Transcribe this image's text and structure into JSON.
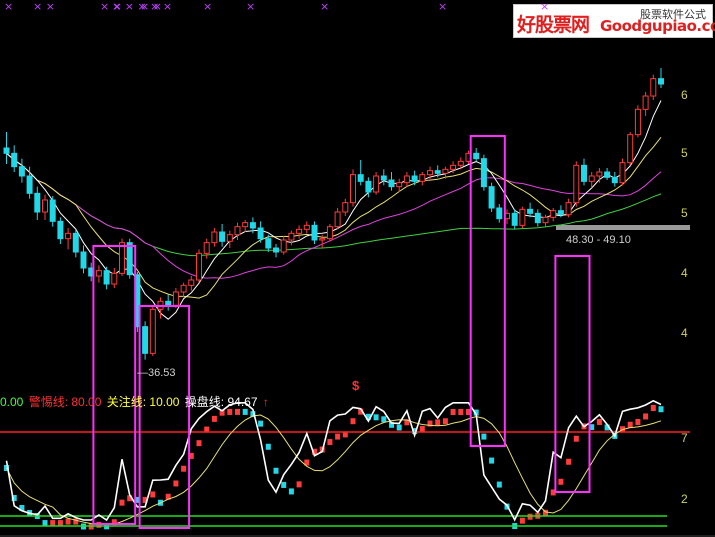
{
  "watermark": {
    "brand": "好股票网",
    "url": "Goodgupiao.com",
    "sub": "股票软件公式"
  },
  "indicator_labels": [
    {
      "text": "0.00",
      "color": "#40ff40"
    },
    {
      "text": "警惕线: 80.00",
      "color": "#ff3030"
    },
    {
      "text": "关注线: 10.00",
      "color": "#ffff40"
    },
    {
      "text": "操盘线: 94.67",
      "color": "#ffffff"
    }
  ],
  "top_marks": [
    "×",
    "× ×",
    "× ×",
    "× ×",
    "× × × × ×",
    "×",
    "×",
    "×",
    "×",
    "×"
  ],
  "y_axis_labels": [
    "6",
    "5",
    "5",
    "4",
    "4",
    "7",
    "2"
  ],
  "price_labels": {
    "low": "36.53",
    "mid": "48.30 - 49.10"
  },
  "signal_text": "$",
  "colors": {
    "up": "#ff3b3b",
    "down": "#20d8e8",
    "ma5": "#ffffff",
    "ma10": "#e8e070",
    "ma20": "#e040e0",
    "ma60": "#40d040",
    "highlight": "#ff30ff",
    "red_line": "#ff2020",
    "green_line": "#20e020"
  },
  "chart_data": {
    "type": "candlestick",
    "upper": {
      "candles_note": "",
      "ohlc": [
        [
          52.4,
          53.6,
          51.2,
          52.0
        ],
        [
          52.0,
          52.6,
          50.6,
          51.0
        ],
        [
          51.0,
          51.6,
          49.8,
          50.3
        ],
        [
          50.3,
          51.0,
          48.6,
          49.0
        ],
        [
          49.0,
          49.5,
          47.0,
          47.6
        ],
        [
          47.6,
          48.9,
          47.0,
          48.5
        ],
        [
          48.5,
          48.8,
          46.5,
          46.9
        ],
        [
          46.9,
          47.2,
          45.2,
          45.6
        ],
        [
          45.6,
          46.4,
          44.8,
          46.0
        ],
        [
          46.0,
          46.3,
          44.2,
          44.6
        ],
        [
          44.6,
          45.1,
          43.0,
          43.4
        ],
        [
          43.4,
          43.8,
          42.4,
          42.8
        ],
        [
          42.8,
          43.6,
          42.3,
          43.2
        ],
        [
          43.2,
          43.5,
          41.8,
          42.2
        ],
        [
          42.2,
          43.4,
          41.9,
          43.0
        ],
        [
          43.0,
          45.6,
          42.8,
          45.3
        ],
        [
          45.3,
          45.6,
          42.6,
          42.9
        ],
        [
          42.9,
          43.1,
          38.6,
          39.0
        ],
        [
          39.0,
          39.4,
          36.53,
          37.0
        ],
        [
          37.0,
          40.6,
          36.8,
          40.3
        ],
        [
          40.3,
          41.2,
          39.6,
          40.9
        ],
        [
          40.9,
          41.4,
          40.2,
          40.6
        ],
        [
          40.6,
          41.9,
          40.4,
          41.6
        ],
        [
          41.6,
          42.3,
          41.2,
          42.1
        ],
        [
          42.1,
          42.8,
          41.7,
          42.5
        ],
        [
          42.5,
          44.8,
          42.3,
          44.5
        ],
        [
          44.5,
          45.6,
          44.1,
          45.3
        ],
        [
          45.3,
          46.4,
          45.0,
          46.1
        ],
        [
          46.1,
          46.7,
          45.0,
          45.4
        ],
        [
          45.4,
          46.2,
          44.9,
          45.9
        ],
        [
          45.9,
          46.8,
          45.5,
          46.5
        ],
        [
          46.5,
          47.0,
          46.1,
          46.8
        ],
        [
          46.8,
          47.2,
          46.0,
          46.4
        ],
        [
          46.4,
          46.9,
          45.3,
          45.6
        ],
        [
          45.6,
          45.9,
          44.6,
          44.9
        ],
        [
          44.9,
          45.2,
          44.2,
          44.6
        ],
        [
          44.6,
          45.8,
          44.4,
          45.5
        ],
        [
          45.5,
          46.2,
          45.1,
          46.0
        ],
        [
          46.0,
          46.6,
          45.6,
          46.3
        ],
        [
          46.3,
          46.9,
          46.0,
          46.6
        ],
        [
          46.6,
          46.9,
          45.2,
          45.5
        ],
        [
          45.5,
          45.9,
          44.9,
          45.6
        ],
        [
          45.6,
          46.7,
          45.4,
          46.5
        ],
        [
          46.5,
          47.9,
          46.3,
          47.6
        ],
        [
          47.6,
          48.6,
          47.3,
          48.3
        ],
        [
          48.3,
          50.8,
          48.0,
          50.4
        ],
        [
          50.4,
          51.5,
          49.6,
          49.9
        ],
        [
          49.9,
          50.2,
          48.7,
          49.1
        ],
        [
          49.1,
          50.6,
          48.9,
          50.3
        ],
        [
          50.3,
          50.8,
          49.6,
          50.0
        ],
        [
          50.0,
          50.6,
          49.2,
          49.5
        ],
        [
          49.5,
          50.1,
          49.1,
          49.8
        ],
        [
          49.8,
          50.6,
          49.5,
          50.3
        ],
        [
          50.3,
          50.7,
          49.6,
          49.9
        ],
        [
          49.9,
          50.6,
          49.6,
          50.4
        ],
        [
          50.4,
          51.0,
          50.0,
          50.7
        ],
        [
          50.7,
          51.1,
          50.2,
          50.5
        ],
        [
          50.5,
          51.0,
          50.1,
          50.8
        ],
        [
          50.8,
          51.4,
          50.5,
          51.1
        ],
        [
          51.1,
          51.7,
          50.8,
          51.4
        ],
        [
          51.4,
          52.2,
          51.2,
          52.0
        ],
        [
          52.0,
          52.4,
          51.4,
          51.6
        ],
        [
          51.6,
          51.9,
          49.2,
          49.5
        ],
        [
          49.5,
          49.8,
          47.6,
          47.9
        ],
        [
          47.9,
          48.2,
          46.8,
          47.1
        ],
        [
          47.1,
          47.8,
          46.7,
          47.5
        ],
        [
          47.5,
          47.8,
          46.3,
          46.6
        ],
        [
          46.6,
          48.0,
          46.4,
          47.8
        ],
        [
          47.8,
          48.3,
          47.2,
          47.5
        ],
        [
          47.5,
          47.8,
          46.5,
          46.8
        ],
        [
          46.8,
          47.4,
          46.5,
          47.2
        ],
        [
          47.2,
          47.9,
          46.9,
          47.7
        ],
        [
          47.7,
          48.1,
          47.2,
          47.4
        ],
        [
          47.4,
          48.6,
          47.2,
          48.3
        ],
        [
          48.3,
          51.4,
          48.0,
          51.1
        ],
        [
          51.1,
          51.6,
          49.6,
          49.9
        ],
        [
          49.9,
          50.6,
          49.4,
          50.3
        ],
        [
          50.3,
          50.9,
          49.8,
          50.6
        ],
        [
          50.6,
          50.9,
          50.0,
          50.2
        ],
        [
          50.2,
          50.6,
          49.5,
          49.8
        ],
        [
          49.8,
          51.6,
          49.6,
          51.3
        ],
        [
          51.3,
          53.6,
          51.1,
          53.4
        ],
        [
          53.4,
          55.6,
          53.2,
          55.3
        ],
        [
          55.3,
          56.6,
          54.8,
          56.3
        ],
        [
          56.3,
          57.9,
          56.0,
          57.6
        ],
        [
          57.6,
          58.4,
          56.9,
          57.2
        ]
      ],
      "price_labels": [
        "36.53",
        "48.30 - 49.10"
      ],
      "ylim": [
        35,
        62
      ]
    },
    "lower": {
      "type": "bar",
      "red_line": 80,
      "green_line": 10,
      "ylim": [
        0,
        100
      ]
    },
    "highlight_boxes": [
      {
        "from": 12,
        "to": 16
      },
      {
        "from": 18,
        "to": 23
      },
      {
        "from": 61,
        "to": 64
      },
      {
        "from": 72,
        "to": 75
      }
    ]
  }
}
